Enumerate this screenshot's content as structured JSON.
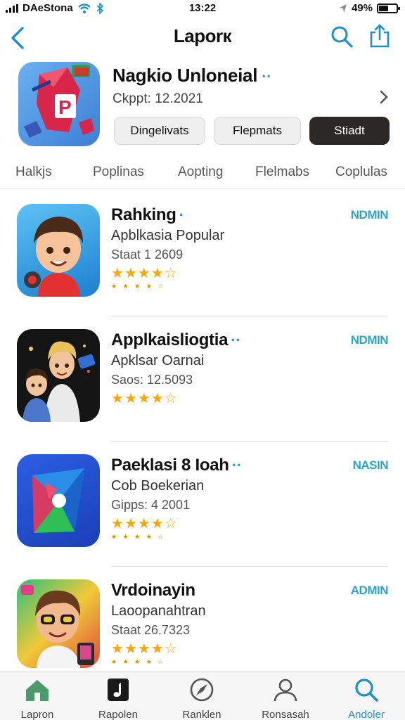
{
  "status_bar": {
    "carrier": "DAeStona",
    "time": "13:22",
    "battery": "49%",
    "battery_level": 0.49
  },
  "nav": {
    "title": "Laporк"
  },
  "featured": {
    "title": "Nagkio Unloneial",
    "subtitle": "Ckppt: 12.2021",
    "buttons": [
      "Dingelivats",
      "Flepmats",
      "Stiadt"
    ]
  },
  "categories": [
    "Halkjs",
    "Poplinas",
    "Aopting",
    "Flelmabs",
    "Coplulas"
  ],
  "apps": [
    {
      "name": "Rahking",
      "description": "Apblkasia Popular",
      "meta": "Staat 1 2609",
      "action": "NDMIN",
      "rating": 4,
      "tiny": "★ ★ ★ ★ ☆"
    },
    {
      "name": "Applkaisliogtia",
      "description": "Apklsar Oarnai",
      "meta": "Saos: 12.5093",
      "action": "NDMIN",
      "rating": 4,
      "tiny": "★ ★ ★ ★ ☆"
    },
    {
      "name": "Paeklasi 8 Ioah",
      "description": "Cob Boekerian",
      "meta": "Gipps: 4 2001",
      "action": "NASIN",
      "rating": 4,
      "tiny": "★ ★ ★ ★ ☆"
    },
    {
      "name": "Vrdoinayin",
      "description": "Laoopanahtran",
      "meta": "Staat 26.7323",
      "action": "ADMIN",
      "rating": 4,
      "tiny": "★ ★ ★ ★ ☆"
    }
  ],
  "tab_bar": {
    "items": [
      "Lapron",
      "Rapolen",
      "Ranklen",
      "Ronsasah",
      "Andoler"
    ],
    "active_index": 4
  },
  "colors": {
    "accent": "#27a7c5",
    "tab_active": "#1f8fc7",
    "dark_button": "#2c2826",
    "star": "#f4a716"
  }
}
